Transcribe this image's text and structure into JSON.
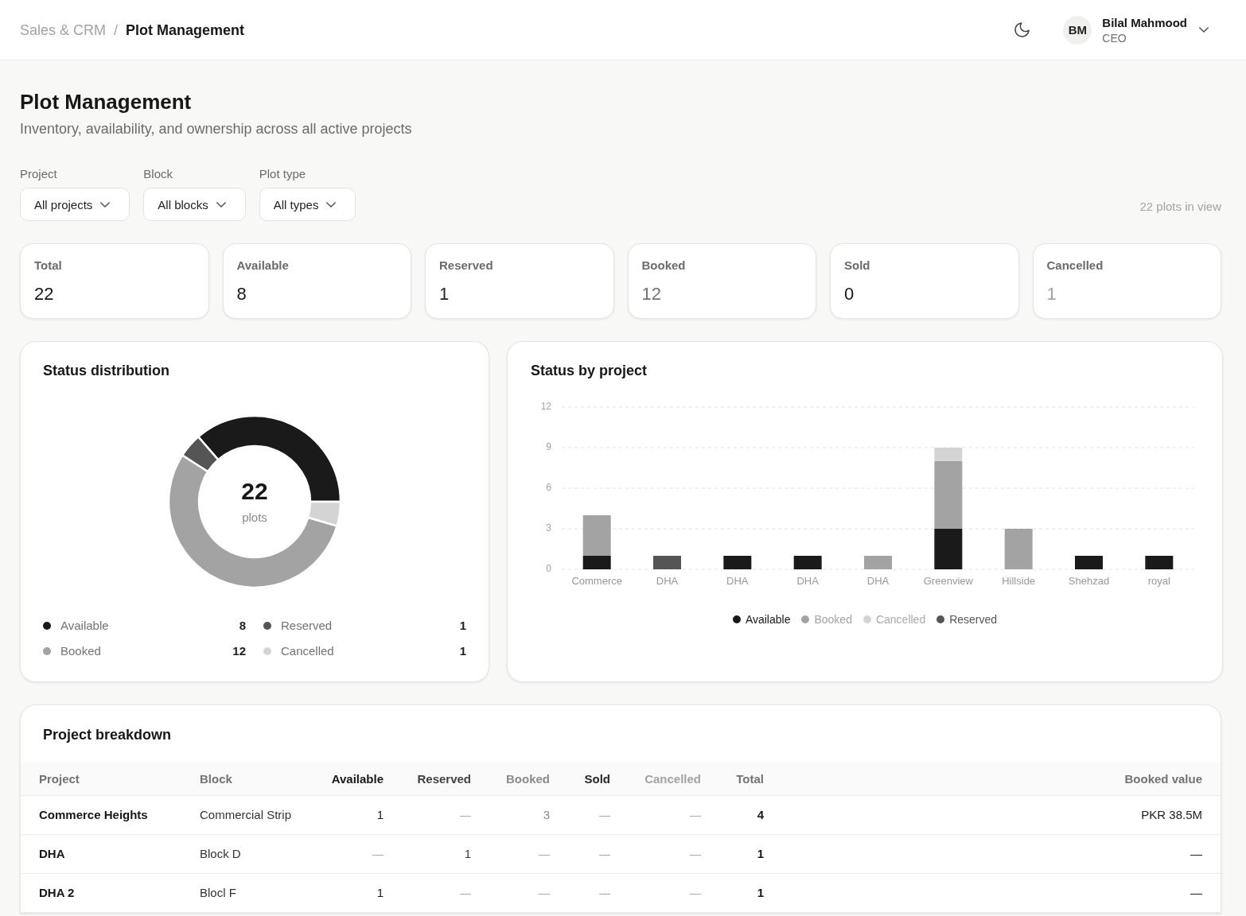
{
  "header": {
    "breadcrumb": [
      {
        "label": "Sales & CRM",
        "current": false
      },
      {
        "label": "Plot Management",
        "current": true
      }
    ],
    "separator": "/",
    "user": {
      "initials": "BM",
      "name": "Bilal Mahmood",
      "role": "CEO"
    }
  },
  "page": {
    "title": "Plot Management",
    "subtitle": "Inventory, availability, and ownership across all active projects"
  },
  "filters": [
    {
      "label": "Project",
      "value": "All projects"
    },
    {
      "label": "Block",
      "value": "All blocks"
    },
    {
      "label": "Plot type",
      "value": "All types"
    }
  ],
  "result_count": "22 plots in view",
  "stats": [
    {
      "label": "Total",
      "value": "22",
      "color": "#171717"
    },
    {
      "label": "Available",
      "value": "8",
      "color": "#171717"
    },
    {
      "label": "Reserved",
      "value": "1",
      "color": "#262626"
    },
    {
      "label": "Booked",
      "value": "12",
      "color": "#737373"
    },
    {
      "label": "Sold",
      "value": "0",
      "color": "#171717"
    },
    {
      "label": "Cancelled",
      "value": "1",
      "color": "#a3a3a3"
    }
  ],
  "status_distribution": {
    "title": "Status distribution",
    "center_value": "22",
    "center_label": "plots",
    "chart_data": {
      "type": "donut",
      "categories": [
        "Available",
        "Reserved",
        "Booked",
        "Cancelled"
      ],
      "values": [
        36.36,
        4.55,
        54.54,
        4.55
      ],
      "legend": "bottom"
    },
    "legend": [
      {
        "value": "8",
        "color": "#1a1a1a"
      },
      {
        "value": "1",
        "color": "#555555"
      },
      {
        "value": "12",
        "color": "#a3a3a3"
      },
      {
        "value": "1",
        "color": "#d4d4d4"
      }
    ]
  },
  "status_by_project": {
    "title": "Status by project",
    "chart_data": {
      "type": "bar",
      "stacked": true,
      "grid": true,
      "legend": "bottom",
      "categories": [
        "Commerce",
        "DHA",
        "DHA",
        "DHA",
        "DHA",
        "Greenview",
        "Hillside",
        "Shehzad",
        "royal"
      ],
      "series": [
        {
          "name": "Available",
          "color": "#1a1a1a",
          "values": [
            1,
            0,
            1,
            1,
            0,
            3,
            0,
            1,
            1
          ]
        },
        {
          "name": "Booked",
          "color": "#a3a3a3",
          "values": [
            3,
            0,
            0,
            0,
            1,
            5,
            3,
            0,
            0
          ]
        },
        {
          "name": "Cancelled",
          "color": "#d4d4d4",
          "values": [
            0,
            0,
            0,
            0,
            0,
            1,
            0,
            0,
            0
          ]
        },
        {
          "name": "Reserved",
          "color": "#555555",
          "values": [
            0,
            1,
            0,
            0,
            0,
            0,
            0,
            0,
            0
          ]
        }
      ],
      "ylim": [
        0,
        12
      ],
      "yticks": [
        0,
        3,
        6,
        9,
        12
      ]
    }
  },
  "project_breakdown": {
    "title": "Project breakdown",
    "columns": [
      {
        "label": "Project",
        "color": "#737373"
      },
      {
        "label": "Block",
        "color": "#737373"
      },
      {
        "label": "Available",
        "color": "#171717"
      },
      {
        "label": "Reserved",
        "color": "#404040"
      },
      {
        "label": "Booked",
        "color": "#8a8a8a"
      },
      {
        "label": "Sold",
        "color": "#262626"
      },
      {
        "label": "Cancelled",
        "color": "#a3a3a3"
      },
      {
        "label": "Total",
        "color": "#737373"
      },
      {
        "label": "Booked value",
        "color": "#737373"
      }
    ],
    "rows": [
      {
        "project": "Commerce Heights",
        "block": "Commercial Strip",
        "counts": [
          {
            "text": "1",
            "empty": false
          },
          {
            "text": "—",
            "empty": true
          },
          {
            "text": "3",
            "empty": false
          },
          {
            "text": "—",
            "empty": true
          },
          {
            "text": "—",
            "empty": true
          }
        ],
        "total": "4",
        "booked_value": "PKR 38.5M"
      },
      {
        "project": "DHA",
        "block": "Block D",
        "counts": [
          {
            "text": "—",
            "empty": true
          },
          {
            "text": "1",
            "empty": false
          },
          {
            "text": "—",
            "empty": true
          },
          {
            "text": "—",
            "empty": true
          },
          {
            "text": "—",
            "empty": true
          }
        ],
        "total": "1",
        "booked_value": "—"
      },
      {
        "project": "DHA 2",
        "block": "Blocl F",
        "counts": [
          {
            "text": "1",
            "empty": false
          },
          {
            "text": "—",
            "empty": true
          },
          {
            "text": "—",
            "empty": true
          },
          {
            "text": "—",
            "empty": true
          },
          {
            "text": "—",
            "empty": true
          }
        ],
        "total": "1",
        "booked_value": "—"
      }
    ]
  }
}
